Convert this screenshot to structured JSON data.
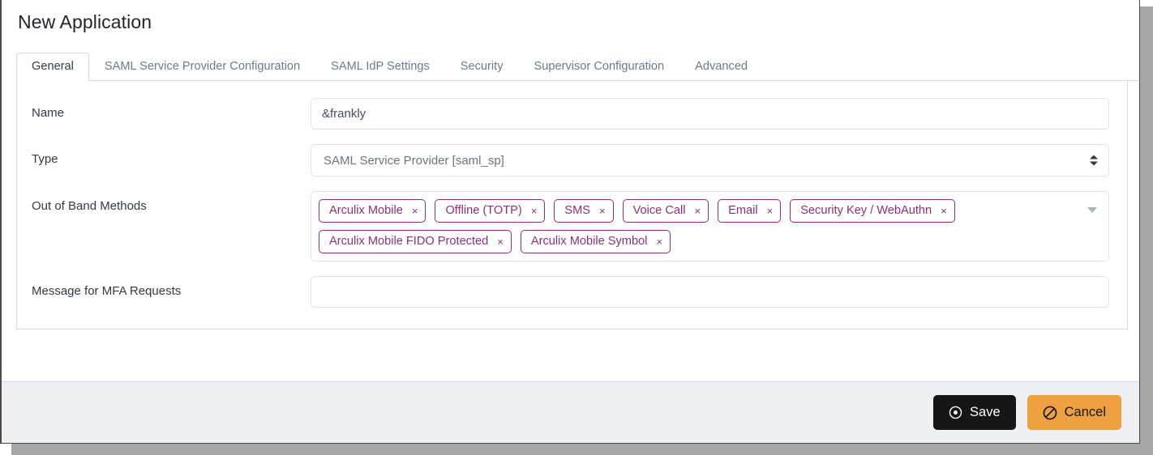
{
  "window": {
    "title": "New Application"
  },
  "tabs": [
    {
      "label": "General",
      "active": true
    },
    {
      "label": "SAML Service Provider Configuration",
      "active": false
    },
    {
      "label": "SAML IdP Settings",
      "active": false
    },
    {
      "label": "Security",
      "active": false
    },
    {
      "label": "Supervisor Configuration",
      "active": false
    },
    {
      "label": "Advanced",
      "active": false
    }
  ],
  "form": {
    "name": {
      "label": "Name",
      "value": "&frankly",
      "placeholder": ""
    },
    "type": {
      "label": "Type",
      "value": "SAML Service Provider [saml_sp]",
      "icon": "stepper-updown-icon"
    },
    "out_of_band_methods": {
      "label": "Out of Band Methods",
      "caret_icon": "chevron-down-icon",
      "remove_glyph": "×",
      "tags": [
        "Arculix Mobile",
        "Offline (TOTP)",
        "SMS",
        "Voice Call",
        "Email",
        "Security Key / WebAuthn",
        "Arculix Mobile FIDO Protected",
        "Arculix Mobile Symbol"
      ]
    },
    "mfa_message": {
      "label": "Message for MFA Requests",
      "value": "",
      "placeholder": ""
    }
  },
  "footer": {
    "save": {
      "label": "Save",
      "icon": "dot-circle-icon"
    },
    "cancel": {
      "label": "Cancel",
      "icon": "ban-icon"
    }
  },
  "colors": {
    "tag_purple": "#8d2f7d",
    "save_bg": "#161616",
    "cancel_bg": "#efa142",
    "footer_bg": "#eef0f3",
    "border": "#d4dae0"
  }
}
